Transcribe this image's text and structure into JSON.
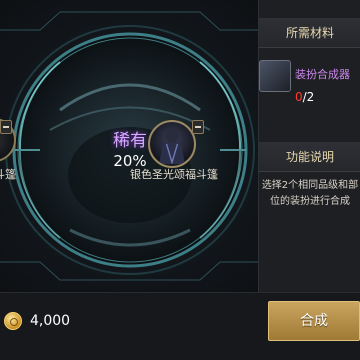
{
  "synthesis": {
    "rarity_label": "稀有",
    "rarity_percent": "20%",
    "left_slot_label": "斗篷",
    "right_slot_label": "银色圣光颂福斗篷"
  },
  "panel": {
    "materials_header": "所需材料",
    "material_name": "装扮合成器",
    "material_have": "0",
    "material_need": "/2",
    "function_header": "功能说明",
    "description": "选择2个相同品级和部位的装扮进行合成"
  },
  "footer": {
    "cost": "4,000",
    "craft_button_label": "合成"
  },
  "icons": {
    "coin": "gold-coin-icon",
    "material": "cube-synthesizer-icon"
  },
  "colors": {
    "rarity": "#d6a8ff",
    "material_name": "#cc88ee",
    "insufficient": "#ff3b30",
    "craft_button": "#b8914a"
  }
}
